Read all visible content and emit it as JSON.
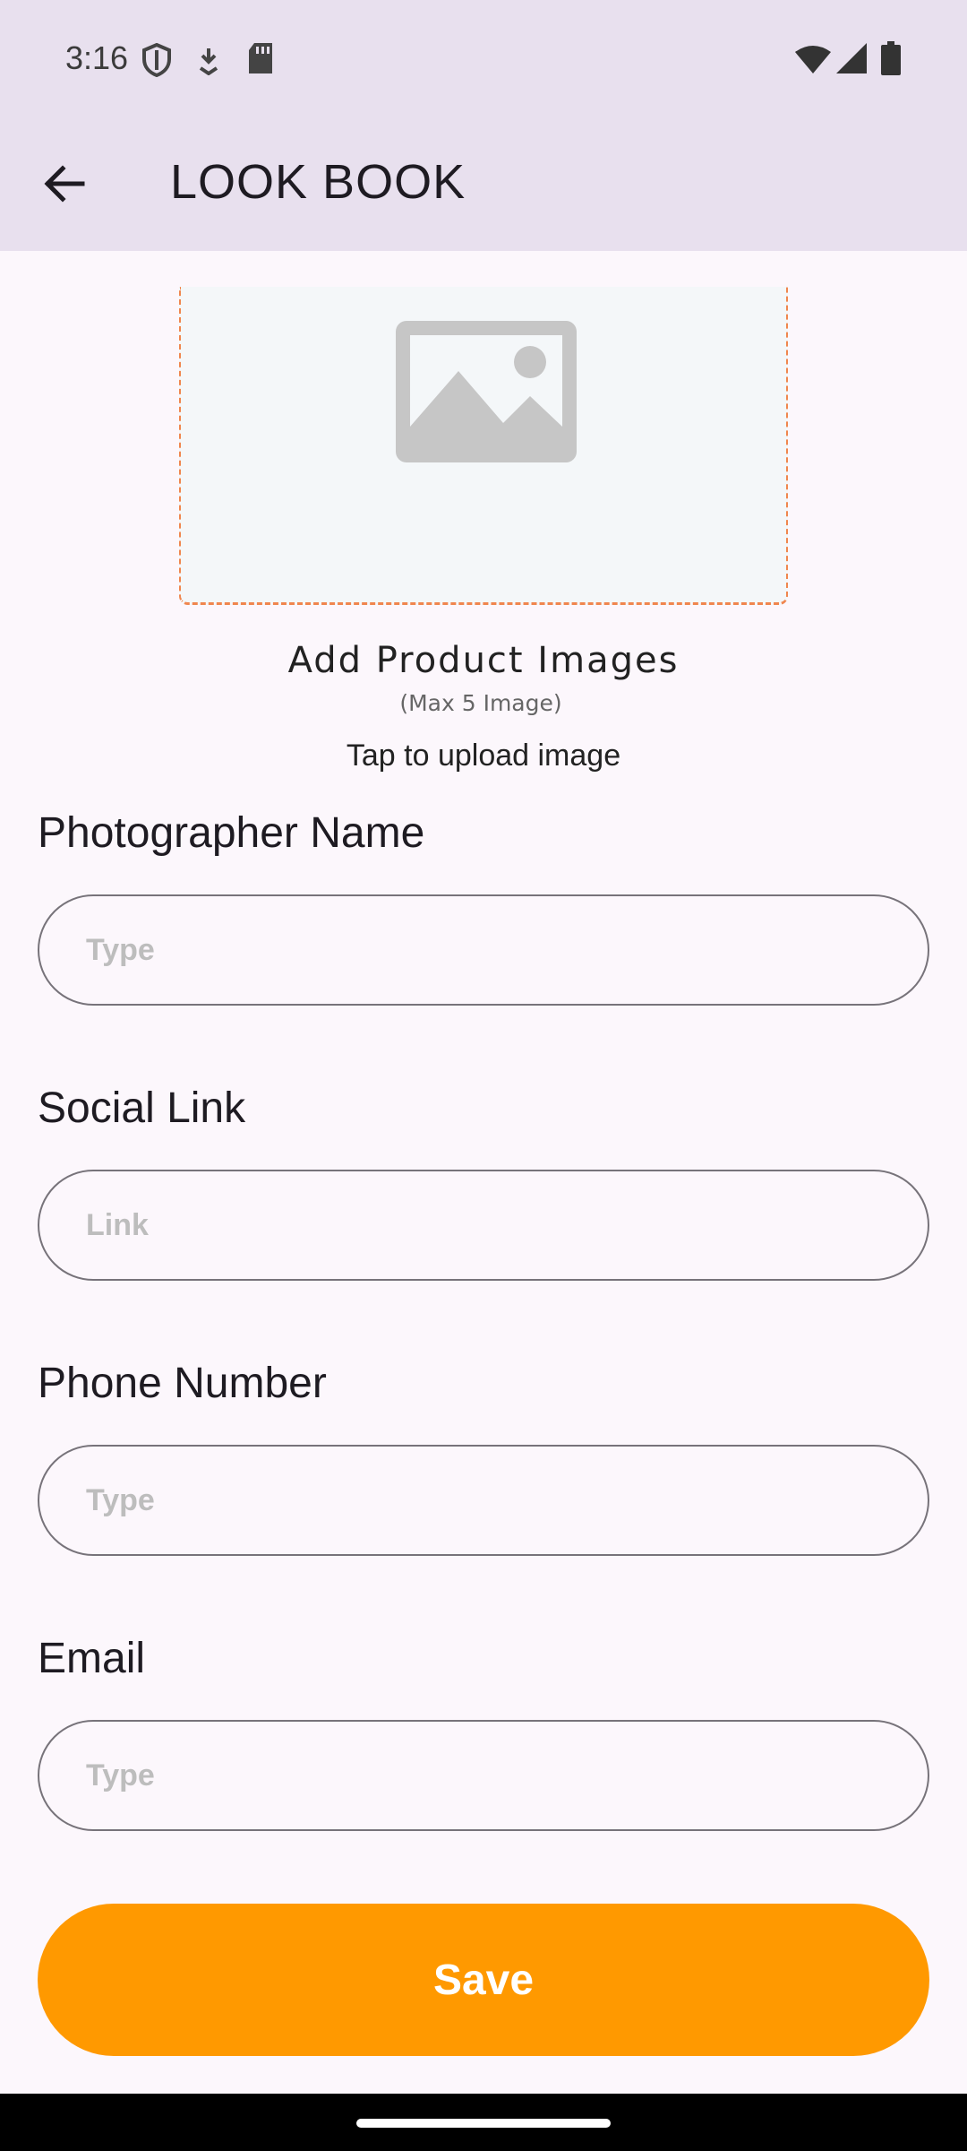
{
  "status_bar": {
    "time": "3:16",
    "left_icons": [
      "shield-icon",
      "download-icon",
      "sd-card-icon"
    ],
    "right_icons": [
      "wifi-icon",
      "signal-icon",
      "battery-icon"
    ]
  },
  "app_bar": {
    "title": "LOOK BOOK",
    "back_icon": "arrow-back-icon"
  },
  "upload": {
    "icon": "image-placeholder-icon",
    "title": "Add Product Images",
    "subtitle": "(Max 5 Image)",
    "hint": "Tap to upload image",
    "border_color": "#F0864E"
  },
  "form": {
    "photographer": {
      "label": "Photographer Name",
      "placeholder": "Type",
      "value": ""
    },
    "social": {
      "label": "Social Link",
      "placeholder": "Link",
      "value": ""
    },
    "phone": {
      "label": "Phone Number",
      "placeholder": "Type",
      "value": ""
    },
    "email": {
      "label": "Email",
      "placeholder": "Type",
      "value": ""
    }
  },
  "actions": {
    "save_label": "Save",
    "save_color": "#FF9900"
  }
}
